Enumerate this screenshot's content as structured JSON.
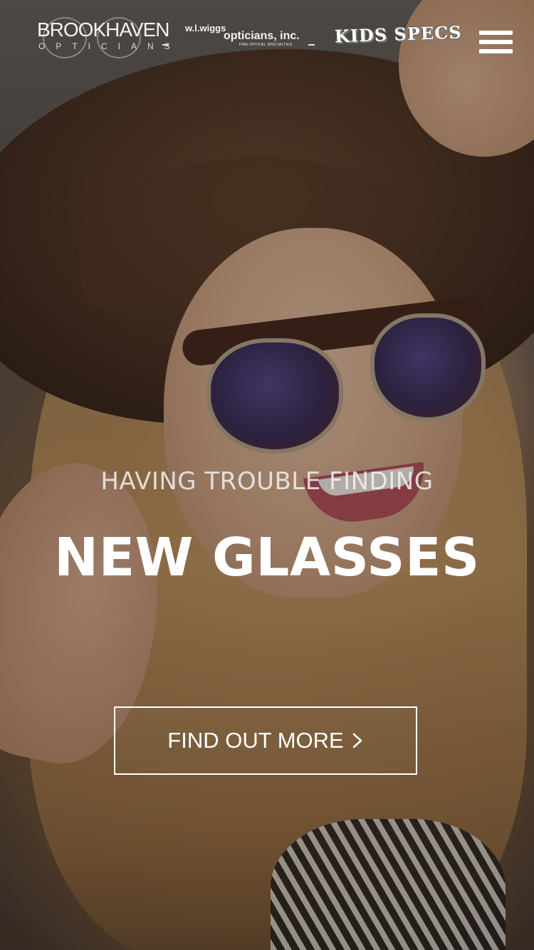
{
  "header": {
    "logos": {
      "brookhaven": {
        "name": "BROOKHAVEN",
        "subtitle": "OPTICIANS"
      },
      "wiggs": {
        "line1": "w.l.wiggs",
        "line2": "opticians, inc.",
        "tagline": "FINE OPTICAL SPECIALTIES"
      },
      "kids_specs": {
        "name": "KIDS SPECS"
      }
    },
    "menu_icon": "hamburger-menu-icon"
  },
  "hero": {
    "kicker": "HAVING TROUBLE FINDING",
    "headline": "NEW GLASSES",
    "cta": {
      "label": "FIND OUT MORE",
      "icon": "chevron-right-icon"
    }
  },
  "colors": {
    "text": "#ffffff",
    "kicker_text": "#f5f5f5",
    "overlay": "#000000"
  }
}
